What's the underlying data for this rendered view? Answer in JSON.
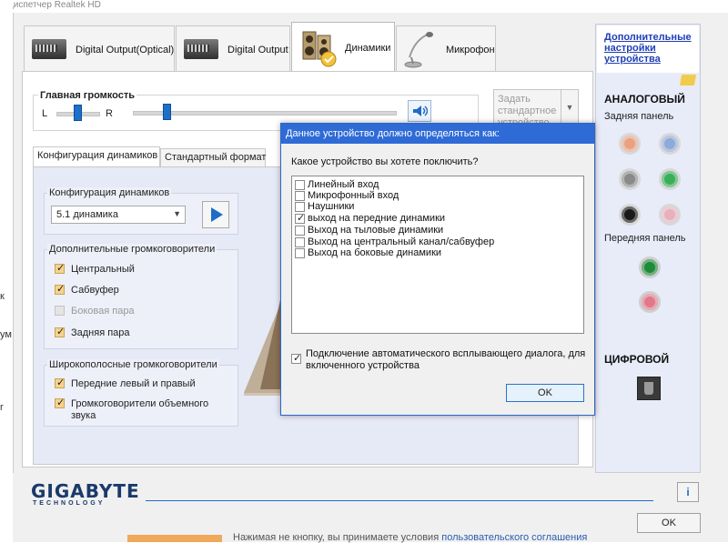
{
  "window_title": "Диспетчер Realtek HD",
  "edge_fragments": [
    "к",
    "ум",
    "r"
  ],
  "tabs": [
    {
      "label": "Digital Output(Optical)",
      "active": false
    },
    {
      "label": "Digital Output",
      "active": false
    },
    {
      "label": "Динамики",
      "active": true
    },
    {
      "label": "Микрофон",
      "active": false
    }
  ],
  "volume": {
    "title": "Главная громкость",
    "left_label": "L",
    "right_label": "R",
    "balance_level": 0.5,
    "master_level": 0.13,
    "set_default_label": "Задать стандартное устройство"
  },
  "inner_tabs": [
    {
      "label": "Конфигурация динамиков",
      "active": true
    },
    {
      "label": "Стандартный формат",
      "active": false
    }
  ],
  "speaker_config": {
    "group_title": "Конфигурация динамиков",
    "selected": "5.1 динамика"
  },
  "extra_speakers": {
    "group_title": "Дополнительные громкоговорители",
    "items": [
      {
        "label": "Центральный",
        "checked": true,
        "enabled": true
      },
      {
        "label": "Сабвуфер",
        "checked": true,
        "enabled": true
      },
      {
        "label": "Боковая пара",
        "checked": false,
        "enabled": false
      },
      {
        "label": "Задняя пара",
        "checked": true,
        "enabled": true
      }
    ]
  },
  "fullrange": {
    "group_title": "Широкополосные громкоговорители",
    "items": [
      {
        "label": "Передние левый и правый",
        "checked": true
      },
      {
        "label": "Громкоговорители объемного звука",
        "checked": true
      }
    ]
  },
  "sidebar": {
    "link": "Дополнительные настройки устройства",
    "analog_title": "АНАЛОГОВЫЙ",
    "rear_panel": "Задняя панель",
    "front_panel": "Передняя панель",
    "digital_title": "ЦИФРОВОЙ",
    "rear_jacks": [
      "#e8a183",
      "#8fa9d8",
      "#8a8a8a",
      "#3cae5a",
      "#1a1a1a",
      "#e6b1bd"
    ],
    "front_jacks": [
      "#1f8a3a",
      "#e07a8a"
    ]
  },
  "dialog": {
    "title": "Данное устройство должно определяться как:",
    "question": "Какое устройство вы хотете поключить?",
    "options": [
      {
        "label": "Линейный вход",
        "checked": false
      },
      {
        "label": "Микрофонный вход",
        "checked": false
      },
      {
        "label": "Наушники",
        "checked": false
      },
      {
        "label": "выход на передние динамики",
        "checked": true
      },
      {
        "label": "Выход на тыловые динамики",
        "checked": false
      },
      {
        "label": "Выход на центральный канал/сабвуфер",
        "checked": false
      },
      {
        "label": "Выход на боковые динамики",
        "checked": false
      }
    ],
    "auto_popup_label": "Подключение автоматического всплывающего диалога, для включенного устройства",
    "auto_popup_checked": true,
    "ok_label": "OK"
  },
  "footer": {
    "brand": "GIGABYTE",
    "brand_sub": "TECHNOLOGY",
    "info_label": "i",
    "ok_label": "OK",
    "bottom_text_a": "Нажимая не кнопку, вы принимаете условия",
    "bottom_text_link": "пользовательского соглашения"
  }
}
